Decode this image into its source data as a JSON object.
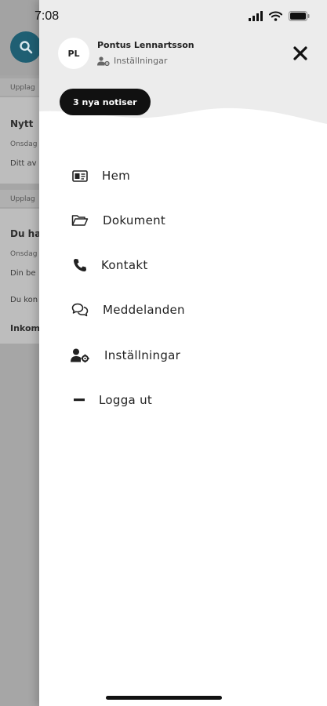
{
  "status_bar": {
    "time": "7:08"
  },
  "background": {
    "line1": "Upplag",
    "title1": "Nytt",
    "date1": "Onsdag",
    "text1": "Ditt av",
    "line2": "Upplag",
    "title2": "Du ha",
    "date2": "Onsdag",
    "text2": "Din be",
    "text3": "Du kon",
    "text4": "Inkom"
  },
  "user": {
    "initials": "PL",
    "name": "Pontus Lennartsson",
    "settings_label": "Inställningar"
  },
  "notifications": {
    "label": "3 nya notiser"
  },
  "menu": {
    "items": [
      {
        "label": "Hem",
        "icon": "id-card-icon"
      },
      {
        "label": "Dokument",
        "icon": "folder-open-icon"
      },
      {
        "label": "Kontakt",
        "icon": "phone-icon"
      },
      {
        "label": "Meddelanden",
        "icon": "chat-bubbles-icon"
      },
      {
        "label": "Inställningar",
        "icon": "user-gear-icon"
      },
      {
        "label": "Logga ut",
        "icon": "minus-icon"
      }
    ]
  },
  "colors": {
    "header_bg": "#ececec",
    "notice_bg": "#111111",
    "accent_search": "#1f5f73",
    "overlay": "#a6a6a6"
  }
}
